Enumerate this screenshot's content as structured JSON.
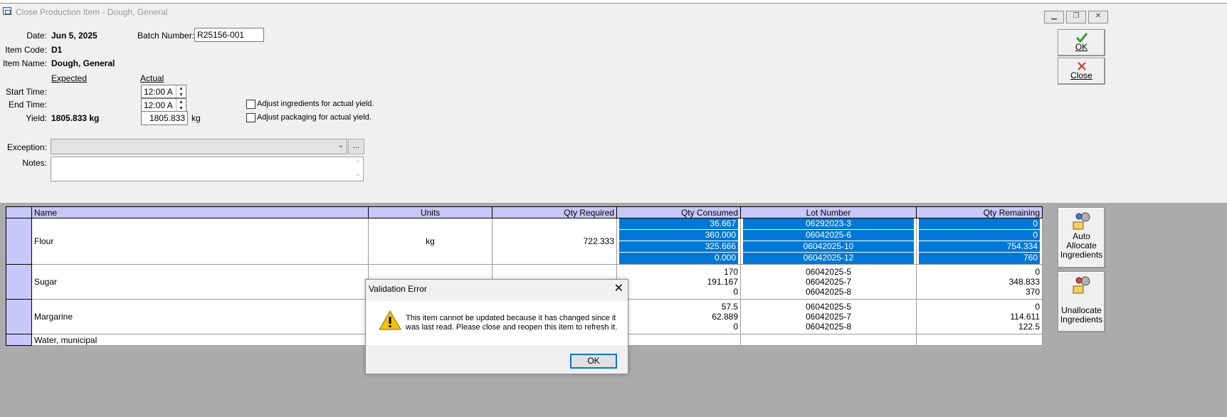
{
  "window": {
    "title": "Close Production Item - Dough, General"
  },
  "form": {
    "date_label": "Date:",
    "date_value": "Jun 5, 2025",
    "batch_label": "Batch Number:",
    "batch_value": "R25156-001",
    "item_code_label": "Item Code:",
    "item_code_value": "D1",
    "item_name_label": "Item Name:",
    "item_name_value": "Dough, General",
    "expected_header": "Expected",
    "actual_header": "Actual",
    "start_label": "Start Time:",
    "start_value": "12:00 A",
    "end_label": "End Time:",
    "end_value": "12:00 A",
    "yield_label": "Yield:",
    "yield_expected": "1805.833 kg",
    "yield_actual": "1805.833",
    "yield_unit": "kg",
    "adjust_ingredients": "Adjust ingredients for actual yield.",
    "adjust_packaging": "Adjust packaging for actual yield.",
    "exception_label": "Exception:",
    "exception_value": "",
    "dots_label": "...",
    "notes_label": "Notes:"
  },
  "buttons": {
    "ok": "OK",
    "close": "Close",
    "auto_allocate": [
      "Auto",
      "Allocate",
      "Ingredients"
    ],
    "unallocate": [
      "Unallocate",
      "Ingredients"
    ]
  },
  "grid": {
    "columns": [
      "Name",
      "Units",
      "Qty Required",
      "Qty Consumed",
      "Lot Number",
      "Qty Remaining"
    ],
    "rows": [
      {
        "name": "Flour",
        "units": "kg",
        "qty_required": "722.333",
        "lots": [
          {
            "consumed": "36.667",
            "lot": "06292023-3",
            "remaining": "0"
          },
          {
            "consumed": "360.000",
            "lot": "06042025-6",
            "remaining": "0"
          },
          {
            "consumed": "325.666",
            "lot": "06042025-10",
            "remaining": "754.334"
          },
          {
            "consumed": "0.000",
            "lot": "06042025-12",
            "remaining": "760"
          }
        ]
      },
      {
        "name": "Sugar",
        "units": "",
        "qty_required": "",
        "lots": [
          {
            "consumed": "170",
            "lot": "06042025-5",
            "remaining": "0"
          },
          {
            "consumed": "191.167",
            "lot": "06042025-7",
            "remaining": "348.833"
          },
          {
            "consumed": "0",
            "lot": "06042025-8",
            "remaining": "370"
          }
        ]
      },
      {
        "name": "Margarine",
        "units": "",
        "qty_required": "",
        "lots": [
          {
            "consumed": "57.5",
            "lot": "06042025-5",
            "remaining": "0"
          },
          {
            "consumed": "62.889",
            "lot": "06042025-7",
            "remaining": "114.611"
          },
          {
            "consumed": "0",
            "lot": "06042025-8",
            "remaining": "122.5"
          }
        ]
      },
      {
        "name": "Water, municipal",
        "units": "",
        "qty_required": "",
        "lots": []
      }
    ]
  },
  "dialog": {
    "title": "Validation Error",
    "message_line1": "This item cannot be updated because it has changed since it",
    "message_line2": "was last read. Please close and reopen this item to refresh it.",
    "ok": "OK"
  },
  "colors": {
    "grid_header": "#c7c7fa",
    "selection": "#0078d7",
    "grid_background": "#ababab",
    "ok_check": "#2e9e2e",
    "close_x": "#d0302b",
    "warning": "#f5c400"
  },
  "icons": [
    "window-app-icon",
    "check-icon",
    "close-x-icon",
    "gears-allocate-icon",
    "gears-unallocate-icon",
    "warning-icon",
    "dropdown-arrow-icon"
  ]
}
